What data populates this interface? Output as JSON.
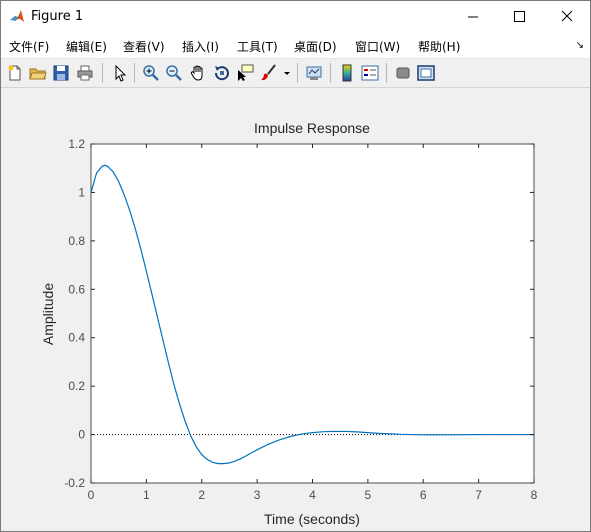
{
  "window": {
    "title": "Figure 1",
    "controls": {
      "minimize": "minimize",
      "maximize": "maximize",
      "close": "close"
    }
  },
  "menubar": {
    "items": [
      {
        "label": "文件(F)"
      },
      {
        "label": "编辑(E)"
      },
      {
        "label": "查看(V)"
      },
      {
        "label": "插入(I)"
      },
      {
        "label": "工具(T)"
      },
      {
        "label": "桌面(D)"
      },
      {
        "label": "窗口(W)"
      },
      {
        "label": "帮助(H)"
      }
    ],
    "overflow_icon": "arrow-icon"
  },
  "toolbar": {
    "buttons": [
      "new-figure-icon",
      "open-file-icon",
      "save-icon",
      "print-icon",
      "edit-plot-icon",
      "zoom-in-icon",
      "zoom-out-icon",
      "pan-icon",
      "rotate-3d-icon",
      "data-cursor-icon",
      "brush-icon",
      "link-plot-icon",
      "insert-colorbar-icon",
      "insert-legend-icon",
      "hide-plot-tools-icon",
      "show-plot-tools-icon"
    ]
  },
  "colors": {
    "line": "#0072bd",
    "axes_text": "#262626",
    "tick_text": "#4d4d4d"
  },
  "chart_data": {
    "type": "line",
    "title": "Impulse Response",
    "xlabel": "Time (seconds)",
    "ylabel": "Amplitude",
    "xlim": [
      0,
      8
    ],
    "ylim": [
      -0.2,
      1.2
    ],
    "xticks": [
      "0",
      "1",
      "2",
      "3",
      "4",
      "5",
      "6",
      "7",
      "8"
    ],
    "yticks": [
      "-0.2",
      "0",
      "0.2",
      "0.4",
      "0.6",
      "0.8",
      "1",
      "1.2"
    ],
    "grid": false,
    "zero_line": "dotted",
    "series": [
      {
        "x": [
          0,
          0.1,
          0.2,
          0.25,
          0.3,
          0.4,
          0.5,
          0.6,
          0.7,
          0.8,
          0.9,
          1.0,
          1.1,
          1.2,
          1.3,
          1.4,
          1.5,
          1.6,
          1.7,
          1.8,
          1.9,
          2.0,
          2.1,
          2.2,
          2.3,
          2.4,
          2.5,
          2.6,
          2.7,
          2.8,
          2.9,
          3.0,
          3.2,
          3.4,
          3.6,
          3.8,
          4.0,
          4.2,
          4.4,
          4.6,
          4.8,
          5.0,
          5.2,
          5.4,
          5.6,
          5.8,
          6.0,
          6.5,
          7.0,
          7.5,
          8.0
        ],
        "y": [
          1.0,
          1.08,
          1.108,
          1.112,
          1.108,
          1.085,
          1.045,
          0.99,
          0.925,
          0.85,
          0.765,
          0.675,
          0.58,
          0.485,
          0.39,
          0.295,
          0.205,
          0.125,
          0.055,
          -0.005,
          -0.05,
          -0.083,
          -0.103,
          -0.115,
          -0.12,
          -0.12,
          -0.117,
          -0.11,
          -0.1,
          -0.088,
          -0.075,
          -0.063,
          -0.04,
          -0.022,
          -0.008,
          0.002,
          0.008,
          0.012,
          0.013,
          0.013,
          0.011,
          0.008,
          0.005,
          0.003,
          0.001,
          0.0,
          -0.001,
          -0.001,
          0.0,
          0.0,
          0.0
        ]
      }
    ]
  }
}
